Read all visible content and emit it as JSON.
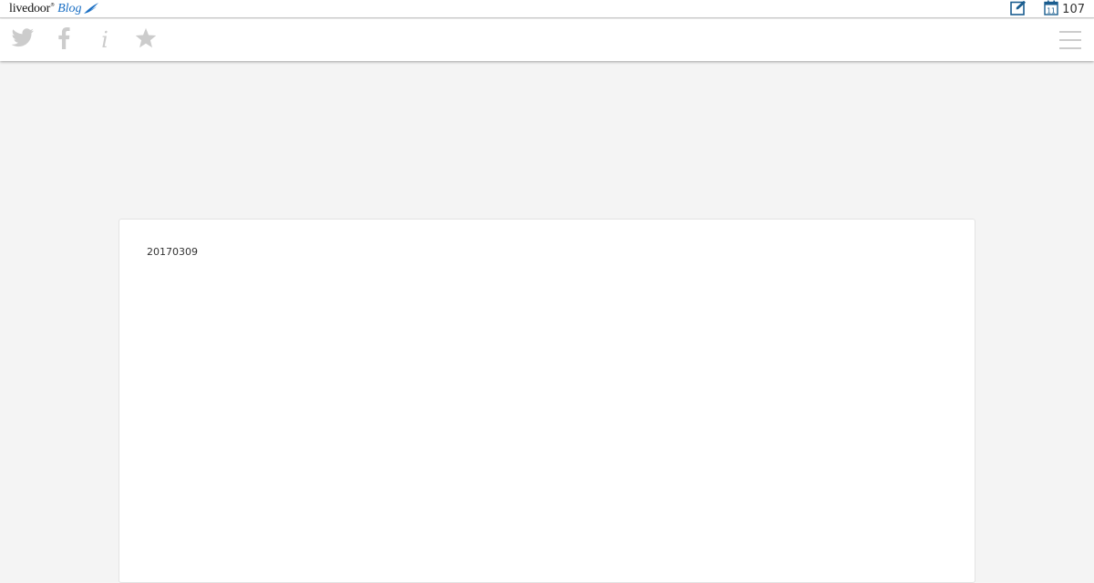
{
  "header": {
    "logo": {
      "brand": "livedoor",
      "registered_mark": "®",
      "product": "Blog",
      "brand_color": "#111111",
      "product_color": "#1a6fc4"
    },
    "edit_icon": "pencil-square-icon",
    "calendar_icon": "calendar-icon",
    "calendar_day": "11",
    "count": "107",
    "icon_color": "#1a5d8f"
  },
  "nav": {
    "icons": [
      "twitter-icon",
      "facebook-icon",
      "info-icon",
      "star-icon"
    ],
    "info_glyph": "i",
    "menu_icon": "hamburger-menu-icon",
    "icon_color": "#cccccc"
  },
  "article": {
    "date": "20170309"
  }
}
